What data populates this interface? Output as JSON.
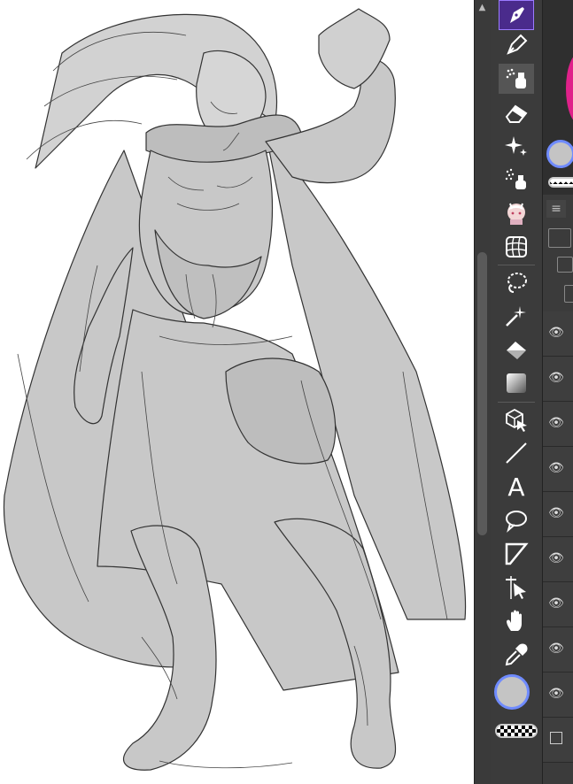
{
  "app": {
    "accent": "#4a2b8c",
    "selected_color": "#c4c4c4",
    "secondary_color": "#e3a074",
    "highlight": "#6f8bff"
  },
  "toolbar": {
    "tools": [
      {
        "name": "pen-nib-tool",
        "icon": "pen-nib-icon",
        "active": true
      },
      {
        "name": "pen-tool",
        "icon": "pen-icon"
      },
      {
        "name": "airbrush-tool",
        "icon": "airbrush-icon",
        "selected": true
      },
      {
        "name": "eraser-tool",
        "icon": "eraser-icon"
      },
      {
        "name": "sparkle-tool",
        "icon": "sparkle-icon"
      },
      {
        "name": "spray-tool",
        "icon": "spray-icon"
      },
      {
        "name": "character-sticker",
        "icon": "character-icon"
      },
      {
        "name": "grid-tool",
        "icon": "grid-icon"
      },
      {
        "name": "lasso-tool",
        "icon": "lasso-icon"
      },
      {
        "name": "magic-wand-tool",
        "icon": "magic-wand-icon"
      },
      {
        "name": "fill-tool",
        "icon": "fill-icon"
      },
      {
        "name": "gradient-tool",
        "icon": "gradient-icon"
      },
      {
        "name": "3d-tool",
        "icon": "cube-cursor-icon"
      },
      {
        "name": "line-tool",
        "icon": "line-icon"
      },
      {
        "name": "text-tool",
        "icon": "text-icon"
      },
      {
        "name": "balloon-tool",
        "icon": "speech-bubble-icon"
      },
      {
        "name": "frame-tool",
        "icon": "frame-icon"
      },
      {
        "name": "correct-line-tool",
        "icon": "correct-line-icon"
      },
      {
        "name": "hand-tool",
        "icon": "hand-icon"
      },
      {
        "name": "eyedropper-tool",
        "icon": "eyedropper-icon"
      }
    ],
    "text_tool_glyph": "A"
  },
  "layers": {
    "menu_glyph": "≡",
    "eye_glyph": "👁",
    "rows": 9
  }
}
